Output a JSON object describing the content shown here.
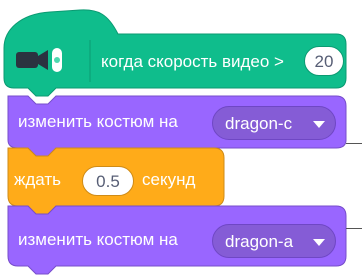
{
  "hat_block": {
    "icon": "video-camera-icon",
    "label": "когда скорость видео >",
    "value": "20",
    "color": "#0fbd8c"
  },
  "blocks": [
    {
      "kind": "looks",
      "label": "изменить костюм на",
      "dropdown_value": "dragon-c",
      "color": "#9966ff"
    },
    {
      "kind": "control",
      "label_before": "ждать",
      "value": "0.5",
      "label_after": "секунд",
      "color": "#ffab19"
    },
    {
      "kind": "looks",
      "label": "изменить костюм на",
      "dropdown_value": "dragon-a",
      "color": "#9966ff"
    }
  ]
}
